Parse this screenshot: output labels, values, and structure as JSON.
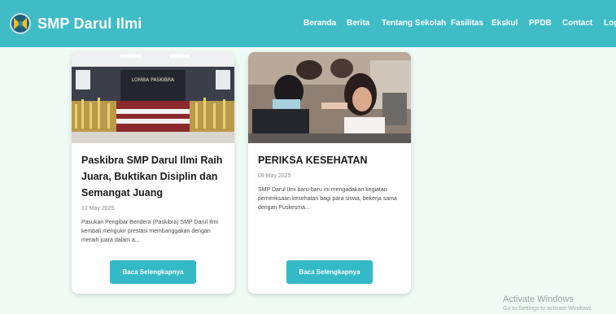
{
  "navbar": {
    "brand": "SMP Darul Ilmi",
    "links": [
      "Beranda",
      "Berita",
      "Tentang Sekolah",
      "Fasilitas",
      "Ekskul",
      "PPDB",
      "Contact",
      "Log"
    ]
  },
  "cards": [
    {
      "title": "Paskibra SMP Darul Ilmi Raih Juara, Buktikan Disiplin dan Semangat Juang",
      "date": "12 May 2025",
      "excerpt": "Pasukan Pengibar Bendera (Paskibra) SMP Darul Ilmi kembali mengukir prestasi membanggakan dengan meraih juara dalam a...",
      "button": "Baca Selengkapnya",
      "image_banner": "LOMBA PASKIBRA"
    },
    {
      "title": "PERIKSA KESEHATAN",
      "date": "09 May 2025",
      "excerpt": "SMP Darul Ilmi baru-baru ini mengadakan kegiatan pemeriksaan kesehatan bagi para siswa, bekerja sama dengan Puskesma...",
      "button": "Baca Selengkapnya"
    }
  ],
  "watermark": {
    "title": "Activate Windows",
    "subtitle": "Go to Settings to activate Windows."
  },
  "colors": {
    "navbar": "#3fbcc6",
    "button": "#34b9c6",
    "page_bg": "#eefaf3"
  }
}
